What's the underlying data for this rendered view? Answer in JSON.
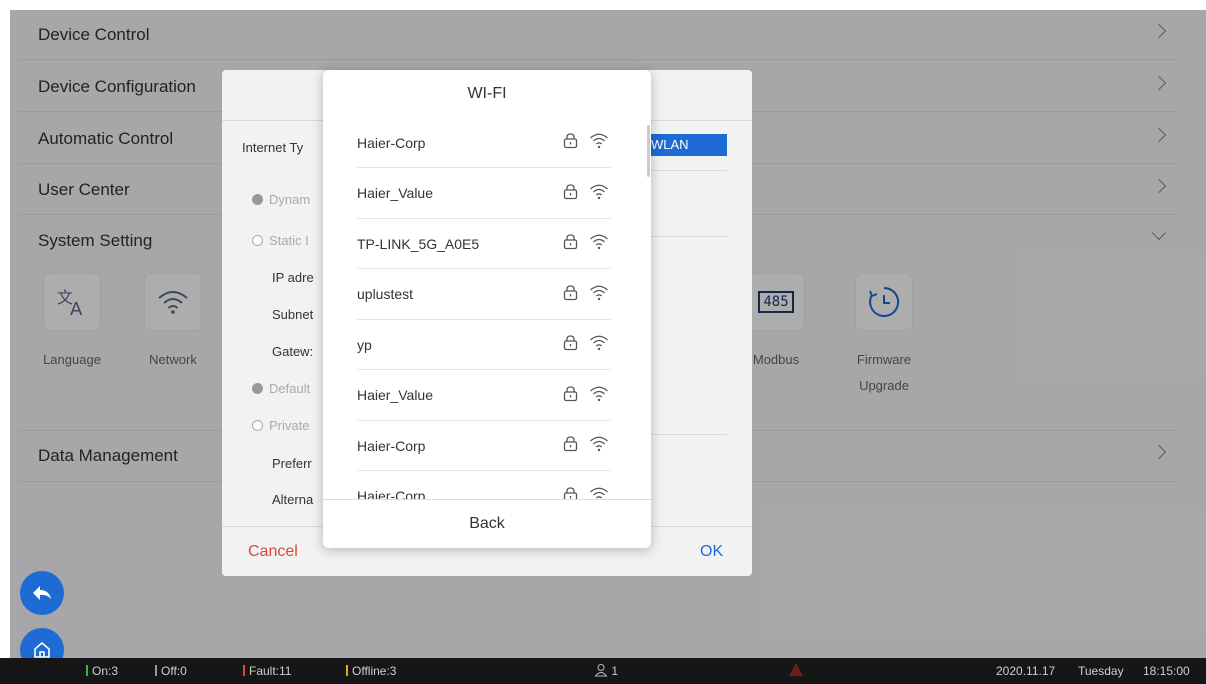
{
  "menu": {
    "device_control": "Device Control",
    "device_configuration": "Device Configuration",
    "automatic_control": "Automatic Control",
    "user_center": "User Center",
    "system_setting": "System Setting",
    "data_management": "Data Management"
  },
  "system_settings": {
    "language": "Language",
    "network": "Network",
    "modbus": "Modbus",
    "modbus_badge": "485",
    "firmware": "Firmware",
    "upgrade": "Upgrade"
  },
  "network_dialog": {
    "internet_type_label": "Internet Ty",
    "internet_type_value": "WLAN",
    "dynamic": "Dynam",
    "static": "Static I",
    "ip_address": "IP adre",
    "subnet": "Subnet",
    "gateway": "Gatew:",
    "default": "Default",
    "private": "Private",
    "preferred": "Preferr",
    "alternate": "Alterna",
    "cancel": "Cancel",
    "ok": "OK"
  },
  "wifi_modal": {
    "title": "WI-FI",
    "networks": [
      {
        "ssid": "Haier-Corp"
      },
      {
        "ssid": "Haier_Value"
      },
      {
        "ssid": "TP-LINK_5G_A0E5"
      },
      {
        "ssid": "uplustest"
      },
      {
        "ssid": "yp"
      },
      {
        "ssid": "Haier_Value"
      },
      {
        "ssid": "Haier-Corp"
      },
      {
        "ssid": "Haier-Corp"
      }
    ],
    "back": "Back"
  },
  "status_bar": {
    "on": "On:3",
    "off": "Off:0",
    "fault": "Fault:11",
    "offline": "Offline:3",
    "users": "1",
    "date": "2020.11.17",
    "weekday": "Tuesday",
    "time": "18:15:00",
    "colors": {
      "on": "#2db84d",
      "off": "#9a9a9a",
      "fault": "#e0453a",
      "offline": "#e6a817"
    }
  },
  "colors": {
    "accent": "#1e6bd6",
    "cancel": "#d9473b",
    "ok": "#1e6bd6"
  },
  "icons": [
    "translate-icon",
    "wifi-icon",
    "clock-icon",
    "lock-icon",
    "back-arrow-icon",
    "home-icon",
    "user-icon",
    "warning-icon"
  ]
}
